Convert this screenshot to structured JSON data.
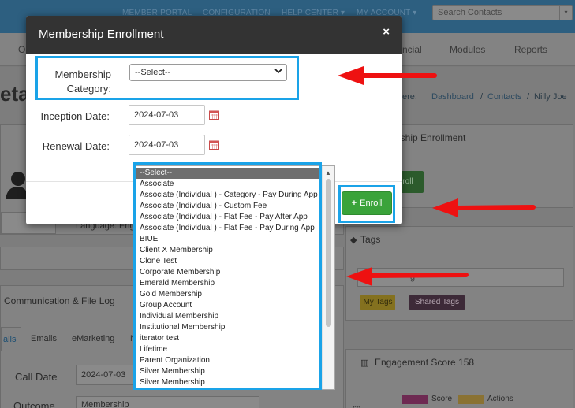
{
  "topnav": {
    "member_portal": "MEMBER PORTAL",
    "configuration": "CONFIGURATION",
    "help_center": "HELP CENTER",
    "my_account": "MY ACCOUNT",
    "caret": "▾",
    "search_placeholder": "Search Contacts"
  },
  "menu": {
    "partial_left": "O",
    "financial": "ncial",
    "modules": "Modules",
    "reports": "Reports"
  },
  "page": {
    "title_partial": "eta",
    "breadcrumb_prefix": "ere:",
    "breadcrumb": [
      "Dashboard",
      "Contacts",
      "Nilly Joe"
    ],
    "language_partial": "Language: Engl",
    "comm_log_title": "Communication & File Log",
    "comm_tabs": [
      "alls",
      "Emails",
      "eMarketing",
      "N"
    ],
    "call_date_label": "Call Date",
    "call_date_value": "2024-07-03",
    "outcome_label": "Outcome",
    "outcome_value": "Membership"
  },
  "right_panels": {
    "membership_enrollment_partial": "ership Enrollment",
    "enroll_partial": "roll",
    "tags_title": "Tags",
    "tag_input_partial": "g",
    "my_tags": "My Tags",
    "shared_tags": "Shared Tags",
    "engagement_title": "Engagement Score 158",
    "legend_score": "Score",
    "legend_actions": "Actions",
    "axis_partial": "60"
  },
  "modal": {
    "title": "Membership Enrollment",
    "close": "×",
    "category_label_line1": "Membership",
    "category_label_line2": "Category:",
    "category_value": "--Select--",
    "inception_label": "Inception Date:",
    "inception_value": "2024-07-03",
    "renewal_label": "Renewal Date:",
    "renewal_value": "2024-07-03",
    "enroll_button": "Enroll",
    "enroll_plus": "+"
  },
  "dropdown_options": [
    "--Select--",
    "Associate",
    "Associate (Individual ) - Category - Pay During App",
    "Associate (Individual ) - Custom Fee",
    "Associate (Individual ) - Flat Fee - Pay After App",
    "Associate (Individual ) - Flat Fee - Pay During App",
    "BIUE",
    "Client X Membership",
    "Clone Test",
    "Corporate Membership",
    "Emerald Membership",
    "Gold Membership",
    "Group Account",
    "Individual Membership",
    "Institutional Membership",
    "iterator test",
    "Lifetime",
    "Parent Organization",
    "Silver Membership",
    "Silver Membership"
  ],
  "colors": {
    "highlight": "#1aa3e8",
    "arrow": "#ee1111",
    "enroll_green": "#3aa33a",
    "modal_header": "#333333"
  }
}
